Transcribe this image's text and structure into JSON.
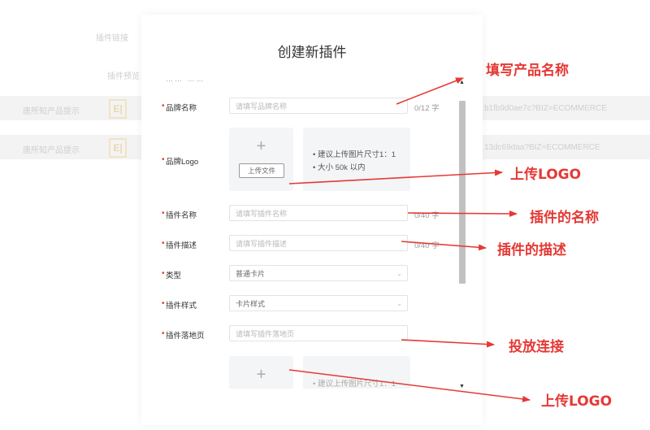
{
  "background": {
    "header_col1": "插件链接",
    "header_col2": "插件预览",
    "row1_name": "唐所知产品提示",
    "row1_logo": "E|",
    "row1_id": "b1fb9d0ae7c?BIZ=ECOMMERCE",
    "row2_name": "唐所知产品提示",
    "row2_logo": "E|",
    "row2_id": "13dc69daa?BIZ=ECOMMERCE"
  },
  "modal": {
    "title": "创建新插件",
    "cut_label": "…… ……",
    "fields": {
      "brand_name": {
        "label": "品牌名称",
        "placeholder": "请填写品牌名称",
        "counter": "0/12 字"
      },
      "brand_logo": {
        "label": "品牌Logo",
        "upload_button": "上传文件",
        "hint1": "• 建议上传图片尺寸1：1",
        "hint2": "• 大小 50k 以内"
      },
      "plugin_name": {
        "label": "插件名称",
        "placeholder": "请填写插件名称",
        "counter": "0/40 字"
      },
      "plugin_desc": {
        "label": "插件描述",
        "placeholder": "请填写插件描述",
        "counter": "0/40 字"
      },
      "type": {
        "label": "类型",
        "value": "普通卡片"
      },
      "style": {
        "label": "插件样式",
        "value": "卡片样式"
      },
      "landing": {
        "label": "插件落地页",
        "placeholder": "请填写插件落地页"
      }
    },
    "plus_glyph": "+",
    "bottom_hint_fragment": "• 建议上传图片尺寸1：1"
  },
  "annotations": {
    "a1": "填写产品名称",
    "a2": "上传LOGO",
    "a3": "插件的名称",
    "a4": "插件的描述",
    "a5": "投放连接",
    "a6": "上传LOGO"
  },
  "colors": {
    "annotation": "#e53935",
    "required": "#e53935",
    "scrollbar": "#c1c1c1"
  },
  "icons": {
    "chevron": "chevron-down-icon",
    "plus": "plus-icon"
  }
}
